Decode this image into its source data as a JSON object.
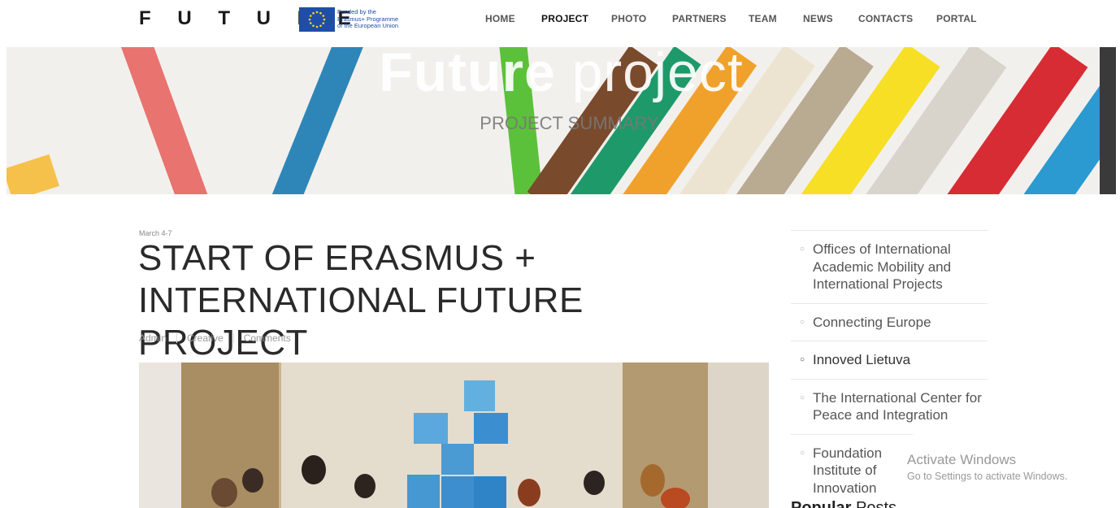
{
  "header": {
    "logo": "F U T U R E",
    "eu_badge_lines": [
      "Funded by the",
      "Erasmus+ Programme",
      "of the European Union"
    ],
    "nav": [
      {
        "label": "HOME",
        "active": false
      },
      {
        "label": "PROJECT",
        "active": true
      },
      {
        "label": "PHOTO",
        "active": false
      },
      {
        "label": "PARTNERS",
        "active": false
      },
      {
        "label": "TEAM",
        "active": false
      },
      {
        "label": "NEWS",
        "active": false
      },
      {
        "label": "CONTACTS",
        "active": false
      },
      {
        "label": "PORTAL",
        "active": false
      }
    ]
  },
  "banner": {
    "title_bold": "Future",
    "title_rest": " project",
    "subtitle": "PROJECT SUMMARY"
  },
  "article": {
    "date": "March 4-7",
    "title": "START OF ERASMUS + INTERNATIONAL FUTURE PROJECT",
    "meta": [
      "Admin",
      "Creative",
      "Comments"
    ]
  },
  "sidebar": {
    "items": [
      {
        "label": "Offices of International Academic Mobility and International Projects",
        "current": false
      },
      {
        "label": "Connecting Europe",
        "current": false
      },
      {
        "label": "Innoved Lietuva",
        "current": true
      },
      {
        "label": "The International Center for Peace and Integration",
        "current": false
      },
      {
        "label": "Foundation Institute of Innovation",
        "current": false
      }
    ],
    "popular_bold": "Popular",
    "popular_rest": " Posts"
  },
  "watermark": {
    "title": "Activate Windows",
    "subtitle": "Go to Settings to activate Windows."
  },
  "colors": {
    "eu_blue": "#1f4ea8",
    "eu_star": "#ffd617"
  }
}
